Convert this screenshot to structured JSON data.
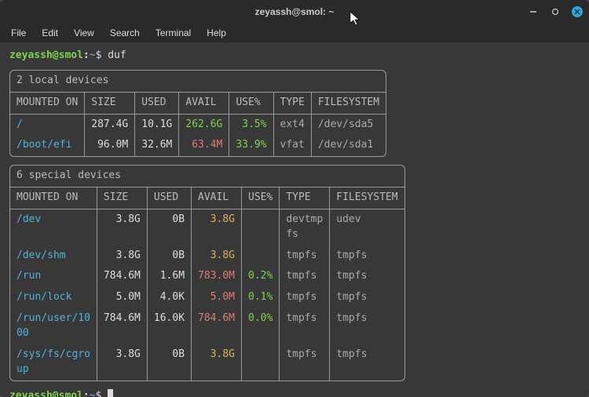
{
  "window": {
    "title": "zeyassh@smol: ~"
  },
  "menu": {
    "file": "File",
    "edit": "Edit",
    "view": "View",
    "search": "Search",
    "terminal": "Terminal",
    "help": "Help"
  },
  "prompt": {
    "user": "zeyassh@smol",
    "path": "~",
    "dollar": "$"
  },
  "command": "duf",
  "local": {
    "title": "2 local devices",
    "headers": [
      "MOUNTED ON",
      "SIZE",
      "USED",
      "AVAIL",
      "USE%",
      "TYPE",
      "FILESYSTEM"
    ],
    "rows": [
      {
        "mount": "/",
        "size": "287.4G",
        "used": "10.1G",
        "avail": "262.6G",
        "avail_cls": "c-avail",
        "use": "3.5%",
        "use_cls": "c-avail",
        "type": "ext4",
        "fs": "/dev/sda5"
      },
      {
        "mount": "/boot/efi",
        "size": "96.0M",
        "used": "32.6M",
        "avail": "63.4M",
        "avail_cls": "c-red",
        "use": "33.9%",
        "use_cls": "c-avail",
        "type": "vfat",
        "fs": "/dev/sda1"
      }
    ]
  },
  "special": {
    "title": "6 special devices",
    "headers": [
      "MOUNTED ON",
      "SIZE",
      "USED",
      "AVAIL",
      "USE%",
      "TYPE",
      "FILESYSTEM"
    ],
    "rows": [
      {
        "mount": "/dev",
        "size": "3.8G",
        "used": "0B",
        "avail": "3.8G",
        "avail_cls": "c-yellow",
        "use": "",
        "use_cls": "",
        "type": "devtmp\nfs",
        "fs": "udev"
      },
      {
        "mount": "/dev/shm",
        "size": "3.8G",
        "used": "0B",
        "avail": "3.8G",
        "avail_cls": "c-yellow",
        "use": "",
        "use_cls": "",
        "type": "tmpfs",
        "fs": "tmpfs"
      },
      {
        "mount": "/run",
        "size": "784.6M",
        "used": "1.6M",
        "avail": "783.0M",
        "avail_cls": "c-red",
        "use": "0.2%",
        "use_cls": "c-avail",
        "type": "tmpfs",
        "fs": "tmpfs"
      },
      {
        "mount": "/run/lock",
        "size": "5.0M",
        "used": "4.0K",
        "avail": "5.0M",
        "avail_cls": "c-red",
        "use": "0.1%",
        "use_cls": "c-avail",
        "type": "tmpfs",
        "fs": "tmpfs"
      },
      {
        "mount": "/run/user/10\n00",
        "size": "784.6M",
        "used": "16.0K",
        "avail": "784.6M",
        "avail_cls": "c-red",
        "use": "0.0%",
        "use_cls": "c-avail",
        "type": "tmpfs",
        "fs": "tmpfs"
      },
      {
        "mount": "/sys/fs/cgro\nup",
        "size": "3.8G",
        "used": "0B",
        "avail": "3.8G",
        "avail_cls": "c-yellow",
        "use": "",
        "use_cls": "",
        "type": "tmpfs",
        "fs": "tmpfs"
      }
    ]
  }
}
